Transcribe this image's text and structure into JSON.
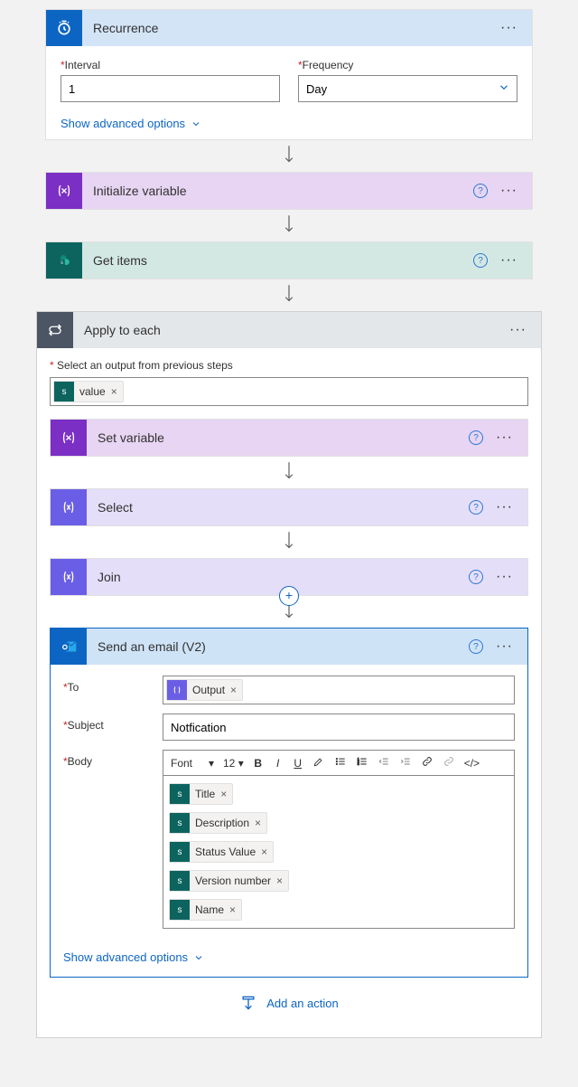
{
  "recurrence": {
    "title": "Recurrence",
    "interval_label": "Interval",
    "interval_value": "1",
    "frequency_label": "Frequency",
    "frequency_value": "Day",
    "advanced": "Show advanced options"
  },
  "initvar": {
    "title": "Initialize variable"
  },
  "getitems": {
    "title": "Get items"
  },
  "apply": {
    "title": "Apply to each",
    "select_label": "Select an output from previous steps",
    "token": "value"
  },
  "setvar": {
    "title": "Set variable"
  },
  "select": {
    "title": "Select"
  },
  "join": {
    "title": "Join"
  },
  "email": {
    "title": "Send an email (V2)",
    "to_label": "To",
    "to_token": "Output",
    "subject_label": "Subject",
    "subject_value": "Notfication",
    "body_label": "Body",
    "toolbar": {
      "font": "Font",
      "size": "12"
    },
    "tokens": [
      "Title",
      "Description",
      "Status Value",
      "Version number",
      "Name"
    ],
    "advanced": "Show advanced options"
  },
  "add_action": "Add an action"
}
